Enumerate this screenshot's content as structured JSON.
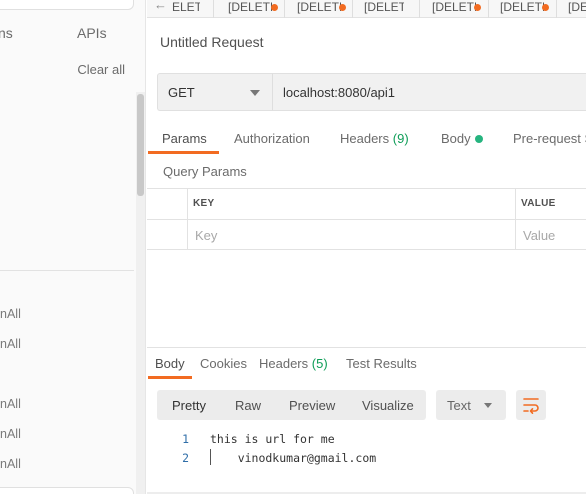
{
  "sidebar": {
    "tabs": [
      {
        "label": "ns"
      },
      {
        "label": "APIs"
      }
    ],
    "clear_all": "Clear all",
    "history": [
      {
        "label": "nAll"
      },
      {
        "label": "nAll"
      },
      {
        "label": "nAll"
      },
      {
        "label": "nAll"
      },
      {
        "label": "nAll"
      }
    ]
  },
  "tabs": [
    {
      "label": "ELETI",
      "unsaved": false
    },
    {
      "label": "[DELETE",
      "unsaved": true
    },
    {
      "label": "[DELETE",
      "unsaved": true
    },
    {
      "label": "[DELETI",
      "unsaved": false
    },
    {
      "label": "[DELETE",
      "unsaved": true
    },
    {
      "label": "[DELETE",
      "unsaved": true
    },
    {
      "label": "[DEL",
      "unsaved": false
    }
  ],
  "request": {
    "title": "Untitled Request",
    "method": "GET",
    "url": "localhost:8080/api1",
    "subtabs": [
      {
        "label": "Params",
        "active": true
      },
      {
        "label": "Authorization"
      },
      {
        "label": "Headers",
        "count": "(9)"
      },
      {
        "label": "Body"
      },
      {
        "label": "Pre-request Scr"
      }
    ],
    "query_params_title": "Query Params",
    "table": {
      "headers": [
        "KEY",
        "VALUE"
      ],
      "key_placeholder": "Key",
      "value_placeholder": "Value"
    }
  },
  "response": {
    "tabs": [
      {
        "label": "Body",
        "active": true
      },
      {
        "label": "Cookies"
      },
      {
        "label": "Headers",
        "count": "(5)"
      },
      {
        "label": "Test Results"
      }
    ],
    "formats": [
      "Pretty",
      "Raw",
      "Preview",
      "Visualize"
    ],
    "language": "Text",
    "lines": [
      {
        "num": "1",
        "text": "this is url for me"
      },
      {
        "num": "2",
        "text": "    vinodkumar@gmail.com"
      }
    ]
  },
  "colors": {
    "accent": "#f26b21",
    "green": "#26b47f"
  }
}
